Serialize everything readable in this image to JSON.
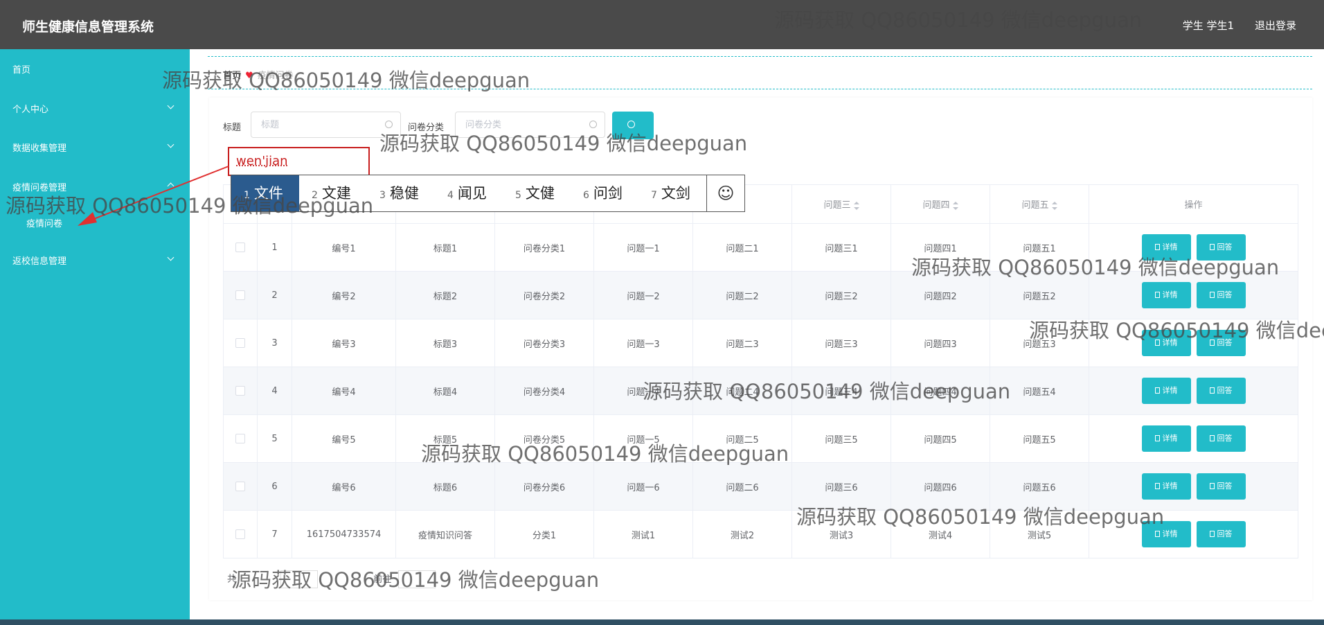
{
  "header": {
    "app_title": "师生健康信息管理系统",
    "user": "学生 学生1",
    "logout": "退出登录"
  },
  "sidebar": {
    "items": [
      {
        "label": "首页"
      },
      {
        "label": "个人中心"
      },
      {
        "label": "数据收集管理"
      },
      {
        "label": "疫情问卷管理"
      },
      {
        "label": "疫情问卷"
      },
      {
        "label": "返校信息管理"
      }
    ]
  },
  "breadcrumb": {
    "home": "首页",
    "current": "疫情问卷"
  },
  "search": {
    "title_label": "标题",
    "title_placeholder": "标题",
    "category_label": "问卷分类",
    "category_placeholder": "问卷分类"
  },
  "ime": {
    "composition": "wen'jian",
    "candidates": [
      {
        "num": "1",
        "text": "文件"
      },
      {
        "num": "2",
        "text": "文建"
      },
      {
        "num": "3",
        "text": "稳健"
      },
      {
        "num": "4",
        "text": "闻见"
      },
      {
        "num": "5",
        "text": "文健"
      },
      {
        "num": "6",
        "text": "问剑"
      },
      {
        "num": "7",
        "text": "文剑"
      }
    ],
    "emoji": "☺"
  },
  "table": {
    "headers": [
      "问题三",
      "问题四",
      "问题五",
      "操作"
    ],
    "rows": [
      [
        "1",
        "编号1",
        "标题1",
        "问卷分类1",
        "问题一1",
        "问题二1",
        "问题三1",
        "问题四1",
        "问题五1"
      ],
      [
        "2",
        "编号2",
        "标题2",
        "问卷分类2",
        "问题一2",
        "问题二2",
        "问题三2",
        "问题四2",
        "问题五2"
      ],
      [
        "3",
        "编号3",
        "标题3",
        "问卷分类3",
        "问题一3",
        "问题二3",
        "问题三3",
        "问题四3",
        "问题五3"
      ],
      [
        "4",
        "编号4",
        "标题4",
        "问卷分类4",
        "问题一4",
        "问题二4",
        "问题三4",
        "问题四4",
        "问题五4"
      ],
      [
        "5",
        "编号5",
        "标题5",
        "问卷分类5",
        "问题一5",
        "问题二5",
        "问题三5",
        "问题四5",
        "问题五5"
      ],
      [
        "6",
        "编号6",
        "标题6",
        "问卷分类6",
        "问题一6",
        "问题二6",
        "问题三6",
        "问题四6",
        "问题五6"
      ],
      [
        "7",
        "1617504733574",
        "疫情知识问答",
        "分类1",
        "测试1",
        "测试2",
        "测试3",
        "测试4",
        "测试5"
      ]
    ],
    "detail_label": "详情",
    "answer_label": "回答"
  },
  "pager": {
    "total_prefix": "共",
    "goto": "前往"
  },
  "watermark": "源码获取 QQ86050149 微信deepguan",
  "colors": {
    "header": "#4a4a4a",
    "sidebar": "#22bcc9",
    "accent": "#22bcc9",
    "ime_border": "#c81e1e",
    "ime_selected": "#2b5b8e"
  }
}
